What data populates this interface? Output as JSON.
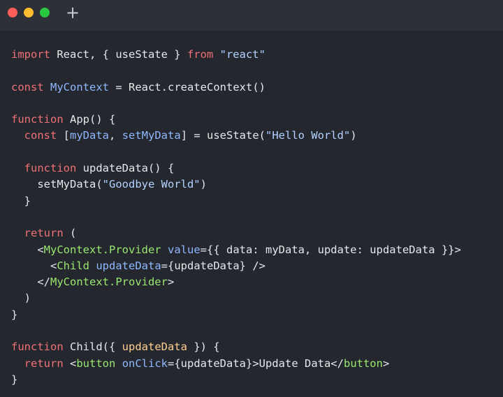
{
  "window": {
    "controls": [
      "close",
      "minimize",
      "maximize"
    ],
    "new_tab_icon": "plus-icon",
    "new_tab_label": "+"
  },
  "colors": {
    "background": "#24272e",
    "titlebar": "#2d3037",
    "keyword": "#f07178",
    "string": "#b4d2ff",
    "identifier": "#8fb8ff",
    "function": "#ffcf91",
    "tag": "#9be870",
    "plain": "#e6e8ec"
  },
  "code": {
    "lines": [
      [
        [
          "keyword",
          "import"
        ],
        [
          "plain",
          " React, { useState } "
        ],
        [
          "keyword",
          "from"
        ],
        [
          "plain",
          " "
        ],
        [
          "string",
          "\"react\""
        ]
      ],
      [],
      [
        [
          "keyword",
          "const"
        ],
        [
          "plain",
          " "
        ],
        [
          "ident",
          "MyContext"
        ],
        [
          "plain",
          " = React.createContext()"
        ]
      ],
      [],
      [
        [
          "keyword",
          "function"
        ],
        [
          "plain",
          " App() {"
        ]
      ],
      [
        [
          "plain",
          "  "
        ],
        [
          "keyword",
          "const"
        ],
        [
          "plain",
          " ["
        ],
        [
          "ident",
          "myData"
        ],
        [
          "plain",
          ", "
        ],
        [
          "ident",
          "setMyData"
        ],
        [
          "plain",
          "] = useState("
        ],
        [
          "string",
          "\"Hello World\""
        ],
        [
          "plain",
          ")"
        ]
      ],
      [],
      [
        [
          "plain",
          "  "
        ],
        [
          "keyword",
          "function"
        ],
        [
          "plain",
          " updateData() {"
        ]
      ],
      [
        [
          "plain",
          "    setMyData("
        ],
        [
          "string",
          "\"Goodbye World\""
        ],
        [
          "plain",
          ")"
        ]
      ],
      [
        [
          "plain",
          "  }"
        ]
      ],
      [],
      [
        [
          "plain",
          "  "
        ],
        [
          "keyword",
          "return"
        ],
        [
          "plain",
          " ("
        ]
      ],
      [
        [
          "plain",
          "    <"
        ],
        [
          "tag",
          "MyContext.Provider"
        ],
        [
          "plain",
          " "
        ],
        [
          "attr",
          "value"
        ],
        [
          "plain",
          "={{ data: myData, update: updateData }}>"
        ]
      ],
      [
        [
          "plain",
          "      <"
        ],
        [
          "tag",
          "Child"
        ],
        [
          "plain",
          " "
        ],
        [
          "attr",
          "updateData"
        ],
        [
          "plain",
          "={updateData} />"
        ]
      ],
      [
        [
          "plain",
          "    </"
        ],
        [
          "tag",
          "MyContext.Provider"
        ],
        [
          "plain",
          ">"
        ]
      ],
      [
        [
          "plain",
          "  )"
        ]
      ],
      [
        [
          "plain",
          "}"
        ]
      ],
      [],
      [
        [
          "keyword",
          "function"
        ],
        [
          "plain",
          " Child({ "
        ],
        [
          "func",
          "updateData"
        ],
        [
          "plain",
          " }) {"
        ]
      ],
      [
        [
          "plain",
          "  "
        ],
        [
          "keyword",
          "return"
        ],
        [
          "plain",
          " <"
        ],
        [
          "tag",
          "button"
        ],
        [
          "plain",
          " "
        ],
        [
          "attr",
          "onClick"
        ],
        [
          "plain",
          "={updateData}>Update Data</"
        ],
        [
          "tag",
          "button"
        ],
        [
          "plain",
          ">"
        ]
      ],
      [
        [
          "plain",
          "}"
        ]
      ]
    ]
  }
}
